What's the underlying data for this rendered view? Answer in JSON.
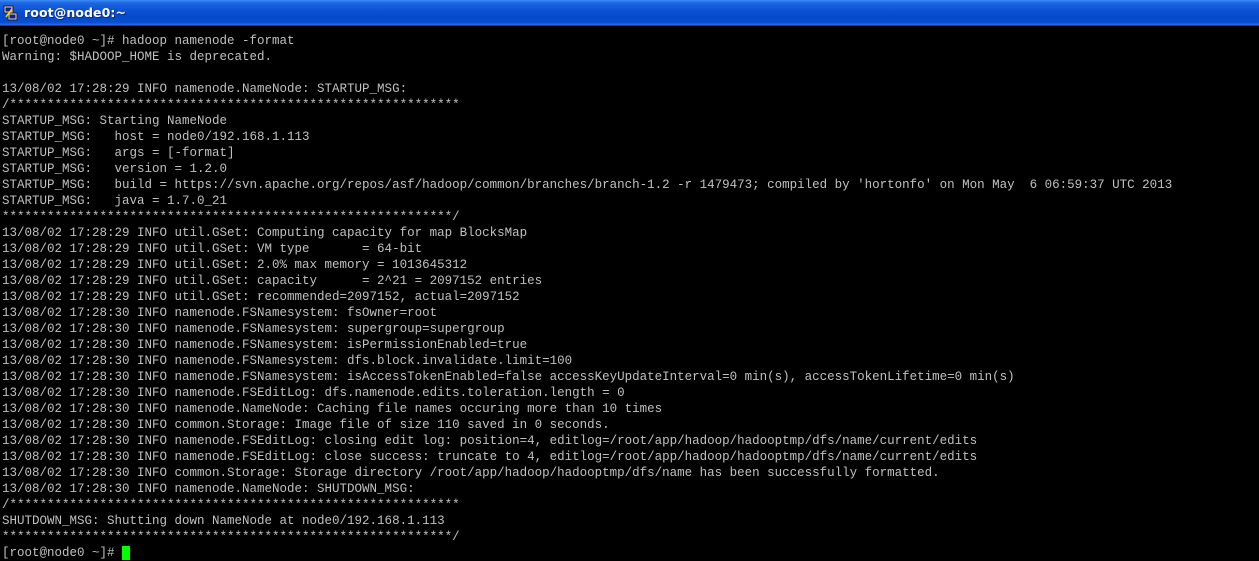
{
  "window": {
    "title": "root@node0:~",
    "icon": "putty-terminal-icon"
  },
  "terminal": {
    "lines": [
      "[root@node0 ~]# hadoop namenode -format",
      "Warning: $HADOOP_HOME is deprecated.",
      "",
      "13/08/02 17:28:29 INFO namenode.NameNode: STARTUP_MSG:",
      "/************************************************************",
      "STARTUP_MSG: Starting NameNode",
      "STARTUP_MSG:   host = node0/192.168.1.113",
      "STARTUP_MSG:   args = [-format]",
      "STARTUP_MSG:   version = 1.2.0",
      "STARTUP_MSG:   build = https://svn.apache.org/repos/asf/hadoop/common/branches/branch-1.2 -r 1479473; compiled by 'hortonfo' on Mon May  6 06:59:37 UTC 2013",
      "STARTUP_MSG:   java = 1.7.0_21",
      "************************************************************/",
      "13/08/02 17:28:29 INFO util.GSet: Computing capacity for map BlocksMap",
      "13/08/02 17:28:29 INFO util.GSet: VM type       = 64-bit",
      "13/08/02 17:28:29 INFO util.GSet: 2.0% max memory = 1013645312",
      "13/08/02 17:28:29 INFO util.GSet: capacity      = 2^21 = 2097152 entries",
      "13/08/02 17:28:29 INFO util.GSet: recommended=2097152, actual=2097152",
      "13/08/02 17:28:30 INFO namenode.FSNamesystem: fsOwner=root",
      "13/08/02 17:28:30 INFO namenode.FSNamesystem: supergroup=supergroup",
      "13/08/02 17:28:30 INFO namenode.FSNamesystem: isPermissionEnabled=true",
      "13/08/02 17:28:30 INFO namenode.FSNamesystem: dfs.block.invalidate.limit=100",
      "13/08/02 17:28:30 INFO namenode.FSNamesystem: isAccessTokenEnabled=false accessKeyUpdateInterval=0 min(s), accessTokenLifetime=0 min(s)",
      "13/08/02 17:28:30 INFO namenode.FSEditLog: dfs.namenode.edits.toleration.length = 0",
      "13/08/02 17:28:30 INFO namenode.NameNode: Caching file names occuring more than 10 times",
      "13/08/02 17:28:30 INFO common.Storage: Image file of size 110 saved in 0 seconds.",
      "13/08/02 17:28:30 INFO namenode.FSEditLog: closing edit log: position=4, editlog=/root/app/hadoop/hadooptmp/dfs/name/current/edits",
      "13/08/02 17:28:30 INFO namenode.FSEditLog: close success: truncate to 4, editlog=/root/app/hadoop/hadooptmp/dfs/name/current/edits",
      "13/08/02 17:28:30 INFO common.Storage: Storage directory /root/app/hadoop/hadooptmp/dfs/name has been successfully formatted.",
      "13/08/02 17:28:30 INFO namenode.NameNode: SHUTDOWN_MSG:",
      "/************************************************************",
      "SHUTDOWN_MSG: Shutting down NameNode at node0/192.168.1.113",
      "************************************************************/"
    ],
    "prompt": "[root@node0 ~]#",
    "text_color": "#c0c0c0",
    "background_color": "#000000",
    "cursor_color": "#00ff00"
  }
}
